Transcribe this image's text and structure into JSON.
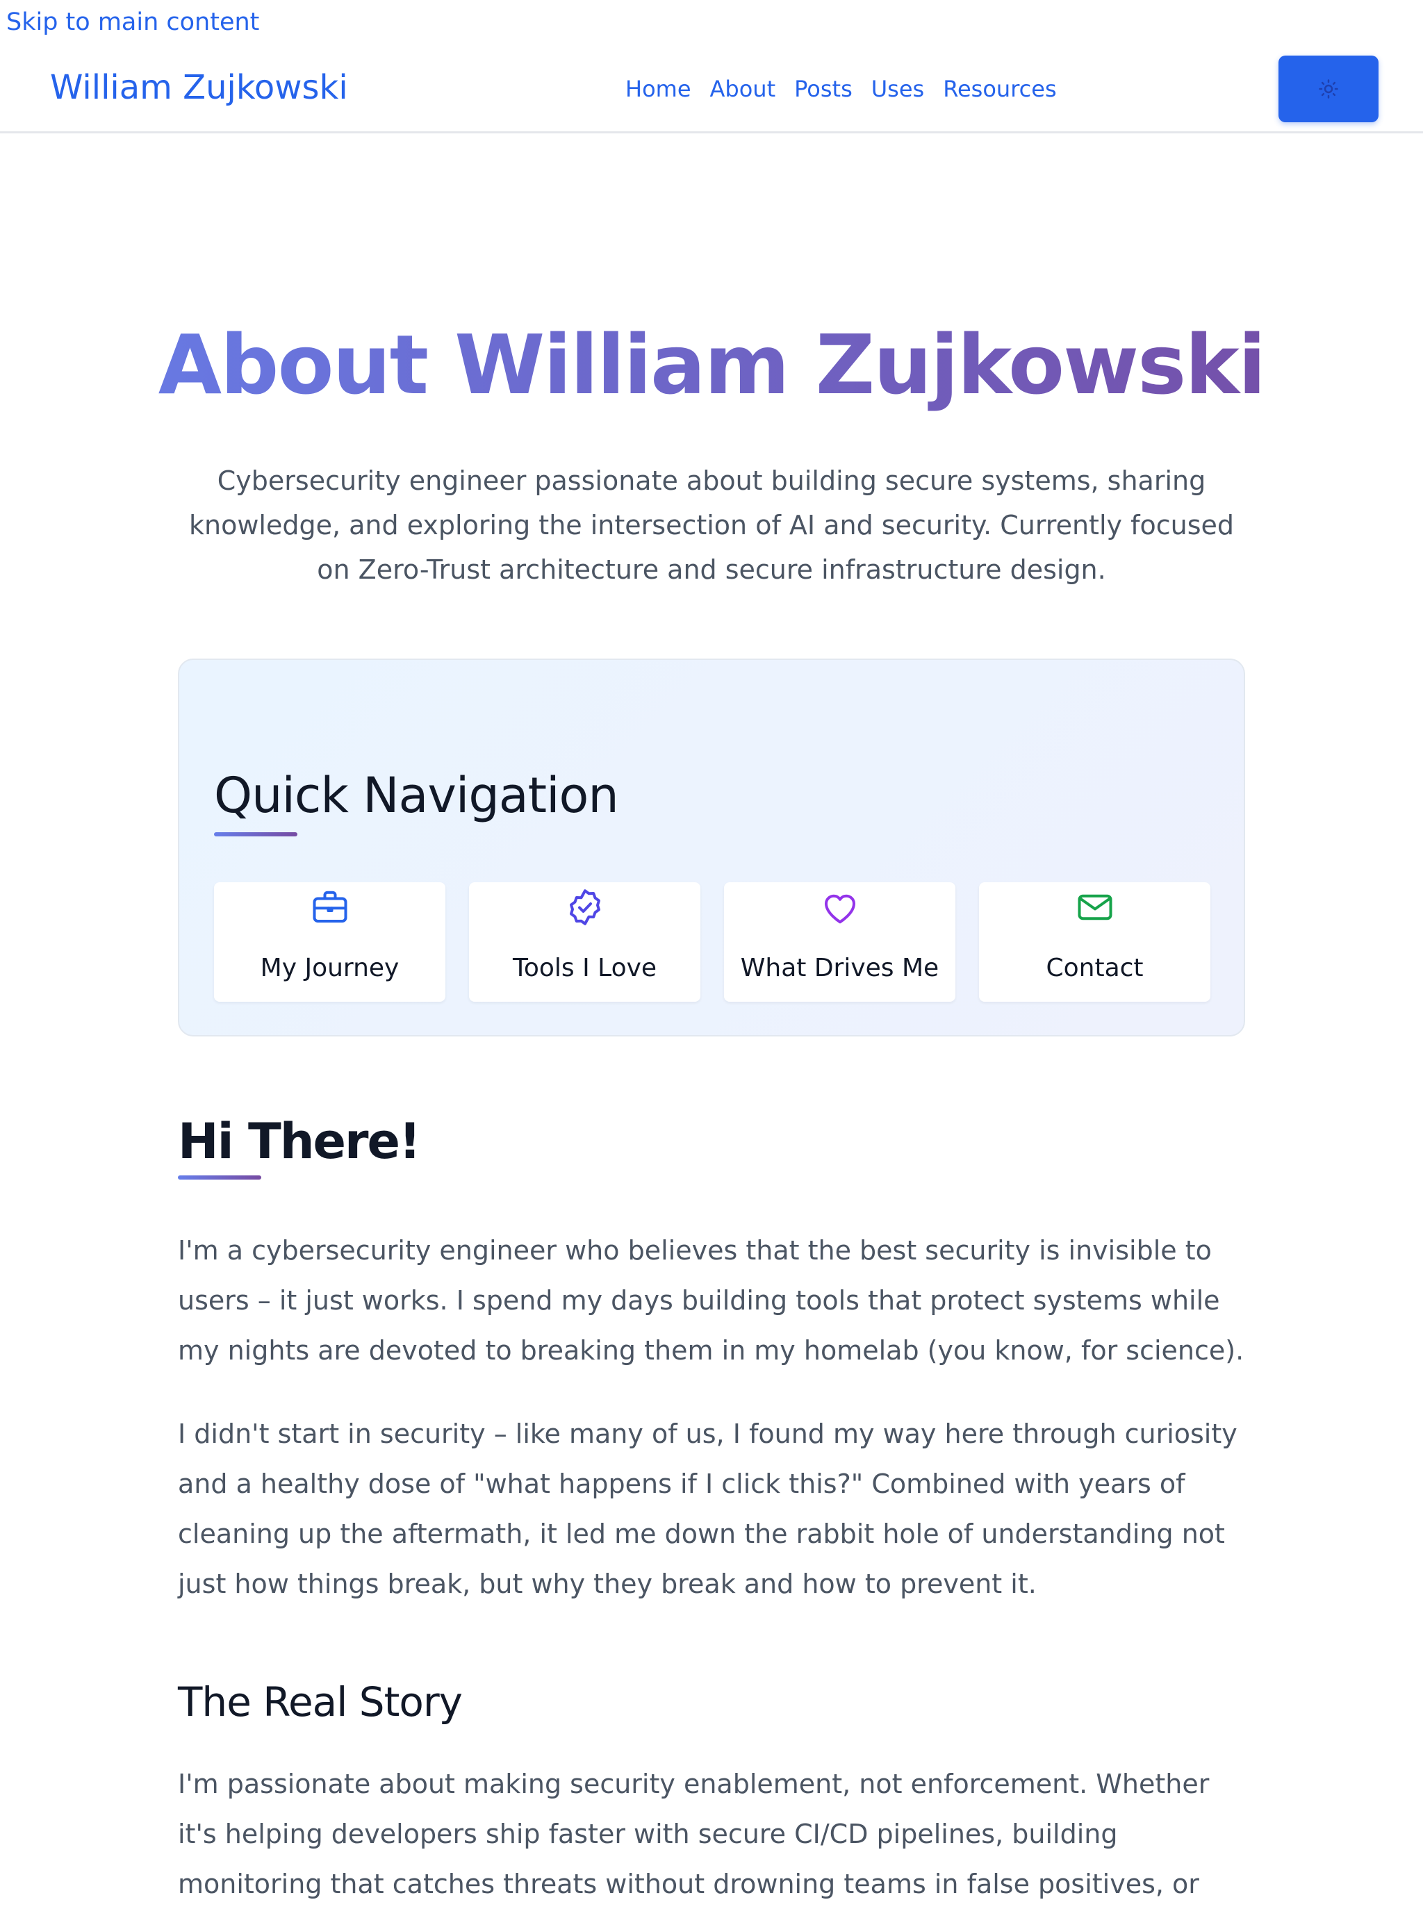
{
  "skip_link": "Skip to main content",
  "header": {
    "site_title": "William Zujkowski",
    "nav": [
      "Home",
      "About",
      "Posts",
      "Uses",
      "Resources"
    ],
    "theme_toggle_icon": "sun-icon"
  },
  "hero": {
    "title": "About William Zujkowski",
    "subtitle": "Cybersecurity engineer passionate about building secure systems, sharing knowledge, and exploring the intersection of AI and security. Currently focused on Zero-Trust architecture and secure infrastructure design."
  },
  "quick_nav": {
    "title": "Quick Navigation",
    "items": [
      {
        "label": "My Journey",
        "icon": "briefcase-icon",
        "color": "#2563eb"
      },
      {
        "label": "Tools I Love",
        "icon": "badge-check-icon",
        "color": "#4f46e5"
      },
      {
        "label": "What Drives Me",
        "icon": "heart-icon",
        "color": "#9333ea"
      },
      {
        "label": "Contact",
        "icon": "mail-icon",
        "color": "#16a34a"
      }
    ]
  },
  "intro": {
    "heading": "Hi There!",
    "paragraphs": [
      "I'm a cybersecurity engineer who believes that the best security is invisible to users – it just works. I spend my days building tools that protect systems while my nights are devoted to breaking them in my homelab (you know, for science).",
      "I didn't start in security – like many of us, I found my way here through curiosity and a healthy dose of \"what happens if I click this?\" Combined with years of cleaning up the aftermath, it led me down the rabbit hole of understanding not just how things break, but why they break and how to prevent it."
    ]
  },
  "story": {
    "heading": "The Real Story",
    "paragraph": "I'm passionate about making security enablement, not enforcement. Whether it's helping developers ship faster with secure CI/CD pipelines, building monitoring that catches threats without drowning teams in false positives, or"
  },
  "colors": {
    "accent": "#2563eb",
    "gradient_start": "#667eea",
    "gradient_end": "#764ba2",
    "text_body": "#4b5563",
    "text_heading": "#111827"
  }
}
